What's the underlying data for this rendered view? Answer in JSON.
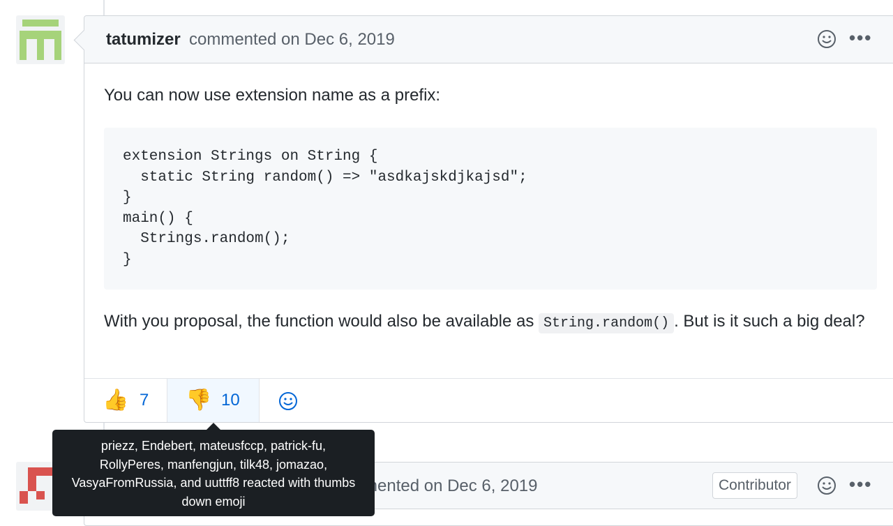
{
  "comment1": {
    "author": "tatumizer",
    "meta": "commented on Dec 6, 2019",
    "paragraph1": "You can now use extension name as a prefix:",
    "code": "extension Strings on String {\n  static String random() => \"asdkajskdjkajsd\";\n}\nmain() {\n  Strings.random();\n}",
    "paragraph2_before": "With you proposal, the function would also be available as ",
    "paragraph2_code": "String.random()",
    "paragraph2_after": ". But is it such a big deal?",
    "reactions": [
      {
        "emoji": "👍",
        "name": "thumbs-up",
        "count": "7"
      },
      {
        "emoji": "👎",
        "name": "thumbs-down",
        "count": "10"
      }
    ],
    "kebab": "•••"
  },
  "comment2": {
    "meta": "mented on Dec 6, 2019",
    "badge": "Contributor",
    "kebab": "•••"
  },
  "tooltip": {
    "text": "priezz, Endebert, mateusfccp, patrick-fu, RollyPeres, manfengjun, tilk48, jomazao, VasyaFromRussia, and uuttff8 reacted with thumbs down emoji"
  },
  "colors": {
    "avatar1": "#a6d37a",
    "avatar2": "#d9534f",
    "link": "#0366d6",
    "tooltip_bg": "#1b1f23"
  }
}
